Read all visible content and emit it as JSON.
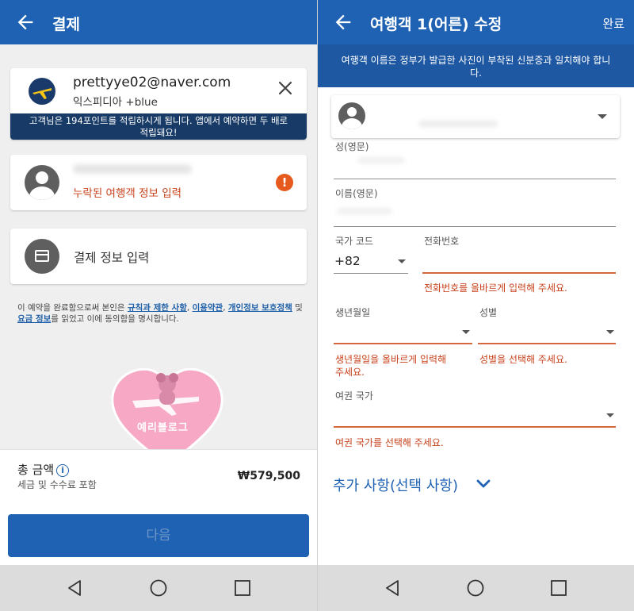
{
  "left": {
    "header": {
      "title": "결제"
    },
    "account": {
      "email": "prettyye02@naver.com",
      "program": "익스피디아 +blue",
      "promo_line1": "고객님은 194포인트를 적립하시게 됩니다. 앱에서 예약하면 두 배로",
      "promo_line2": "적립돼요!"
    },
    "traveler": {
      "missing_label": "누락된 여행객 정보 입력",
      "alert_symbol": "!"
    },
    "payment": {
      "label": "결제 정보 입력"
    },
    "terms": {
      "prefix": "이 예약을 완료함으로써 본인은 ",
      "link1": "규칙과 제한 사항",
      "sep1": ", ",
      "link2": "이용약관",
      "sep2": ", ",
      "link3": "개인정보 보호정책",
      "sep3": " 및 ",
      "link4": "요금 정보",
      "suffix": "를 읽었고 이에 동의함을 명시합니다."
    },
    "watermark": {
      "text": "예리블로그"
    },
    "summary": {
      "total_label": "총 금액",
      "info_symbol": "i",
      "tax_note": "세금 및 수수료 포함",
      "price": "₩579,500"
    },
    "next_button": "다음"
  },
  "right": {
    "header": {
      "title": "여행객 1(어른) 수정",
      "done": "완료"
    },
    "notice": "여행객 이름은 정부가 발급한 사진이 부착된 신분증과 일치해야 합니다.",
    "fields": {
      "last_name_label": "성(영문)",
      "first_name_label": "이름(영문)",
      "country_code_label": "국가 코드",
      "country_code_value": "+82",
      "phone_label": "전화번호",
      "phone_error": "전화번호를 올바르게 입력해 주세요.",
      "birth_label": "생년월일",
      "birth_error_line1": "생년월일을 올바르게 입력해",
      "birth_error_line2": "주세요.",
      "gender_label": "성별",
      "gender_error": "성별을 선택해 주세요.",
      "passport_label": "여권 국가",
      "passport_error": "여권 국가를 선택해 주세요."
    },
    "extra": "추가 사항(선택 사항)"
  },
  "colors": {
    "appbar": "#1f62b3",
    "notice": "#1e58a3",
    "promo": "#173a66",
    "error": "#c8411b",
    "alert": "#e65a1e",
    "link": "#1d5fa8"
  },
  "icons": {
    "back": "arrow-left-icon",
    "close": "close-icon",
    "logo": "airplane-globe-icon",
    "alert": "exclamation-circle-icon",
    "payment": "credit-card-icon",
    "info": "info-circle-icon",
    "nav_back": "triangle-back-icon",
    "nav_home": "circle-home-icon",
    "nav_recent": "square-recent-icon",
    "chevron": "chevron-down-icon"
  }
}
